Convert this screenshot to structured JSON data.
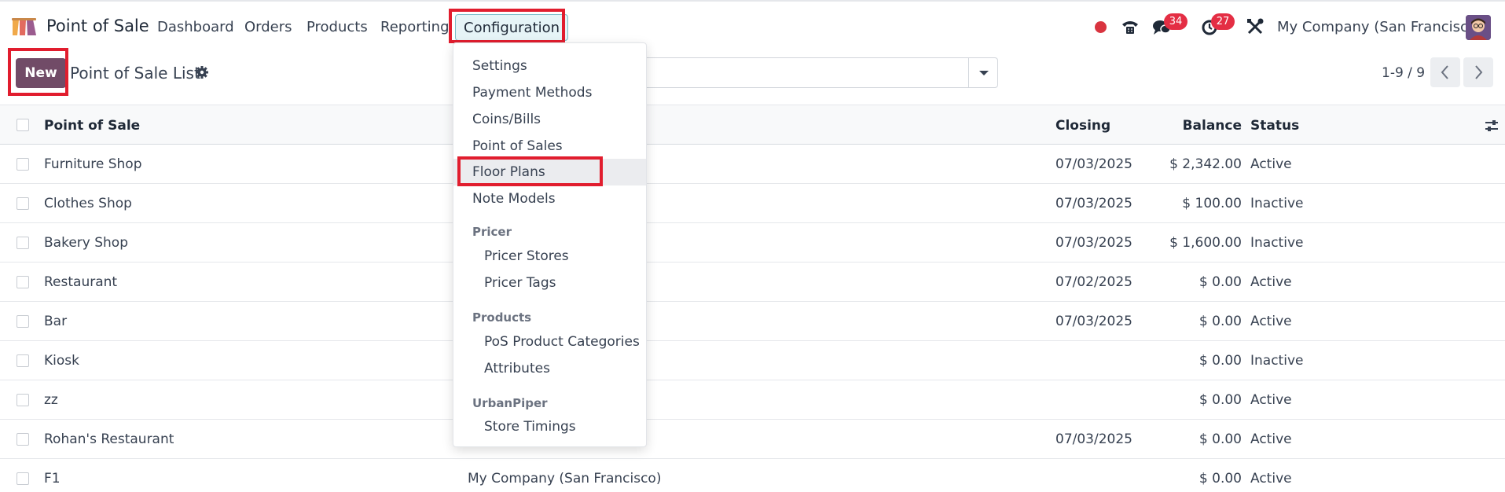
{
  "navbar": {
    "app_name": "Point of Sale",
    "menu": [
      "Dashboard",
      "Orders",
      "Products",
      "Reporting"
    ],
    "active_menu": "Configuration",
    "chat_count": "34",
    "activity_count": "27",
    "company": "My Company (San Francisco)"
  },
  "control": {
    "new_label": "New",
    "title": "Point of Sale List",
    "pager": "1-9 / 9"
  },
  "list": {
    "columns": {
      "name": "Point of Sale",
      "closing": "Closing",
      "balance": "Balance",
      "status": "Status"
    },
    "rows": [
      {
        "name": "Furniture Shop",
        "company": "",
        "closing": "07/03/2025",
        "balance": "$ 2,342.00",
        "status": "Active"
      },
      {
        "name": "Clothes Shop",
        "company": "",
        "closing": "07/03/2025",
        "balance": "$ 100.00",
        "status": "Inactive"
      },
      {
        "name": "Bakery Shop",
        "company": "",
        "closing": "07/03/2025",
        "balance": "$ 1,600.00",
        "status": "Inactive"
      },
      {
        "name": "Restaurant",
        "company": "",
        "closing": "07/02/2025",
        "balance": "$ 0.00",
        "status": "Active"
      },
      {
        "name": "Bar",
        "company": "",
        "closing": "07/03/2025",
        "balance": "$ 0.00",
        "status": "Active"
      },
      {
        "name": "Kiosk",
        "company": "",
        "closing": "",
        "balance": "$ 0.00",
        "status": "Inactive"
      },
      {
        "name": "zz",
        "company": "",
        "closing": "",
        "balance": "$ 0.00",
        "status": "Active"
      },
      {
        "name": "Rohan's Restaurant",
        "company": "",
        "closing": "07/03/2025",
        "balance": "$ 0.00",
        "status": "Active"
      },
      {
        "name": "F1",
        "company": "My Company (San Francisco)",
        "closing": "",
        "balance": "$ 0.00",
        "status": "Active"
      }
    ]
  },
  "dropdown": {
    "items": [
      "Settings",
      "Payment Methods",
      "Coins/Bills",
      "Point of Sales",
      "Floor Plans",
      "Note Models"
    ],
    "sections": [
      {
        "header": "Pricer",
        "items": [
          "Pricer Stores",
          "Pricer Tags"
        ]
      },
      {
        "header": "Products",
        "items": [
          "PoS Product Categories",
          "Attributes"
        ]
      },
      {
        "header": "UrbanPiper",
        "items": [
          "Store Timings"
        ]
      }
    ]
  },
  "colors": {
    "primary": "#714b67",
    "highlight": "#e11d2e",
    "badge": "#e42e44"
  }
}
